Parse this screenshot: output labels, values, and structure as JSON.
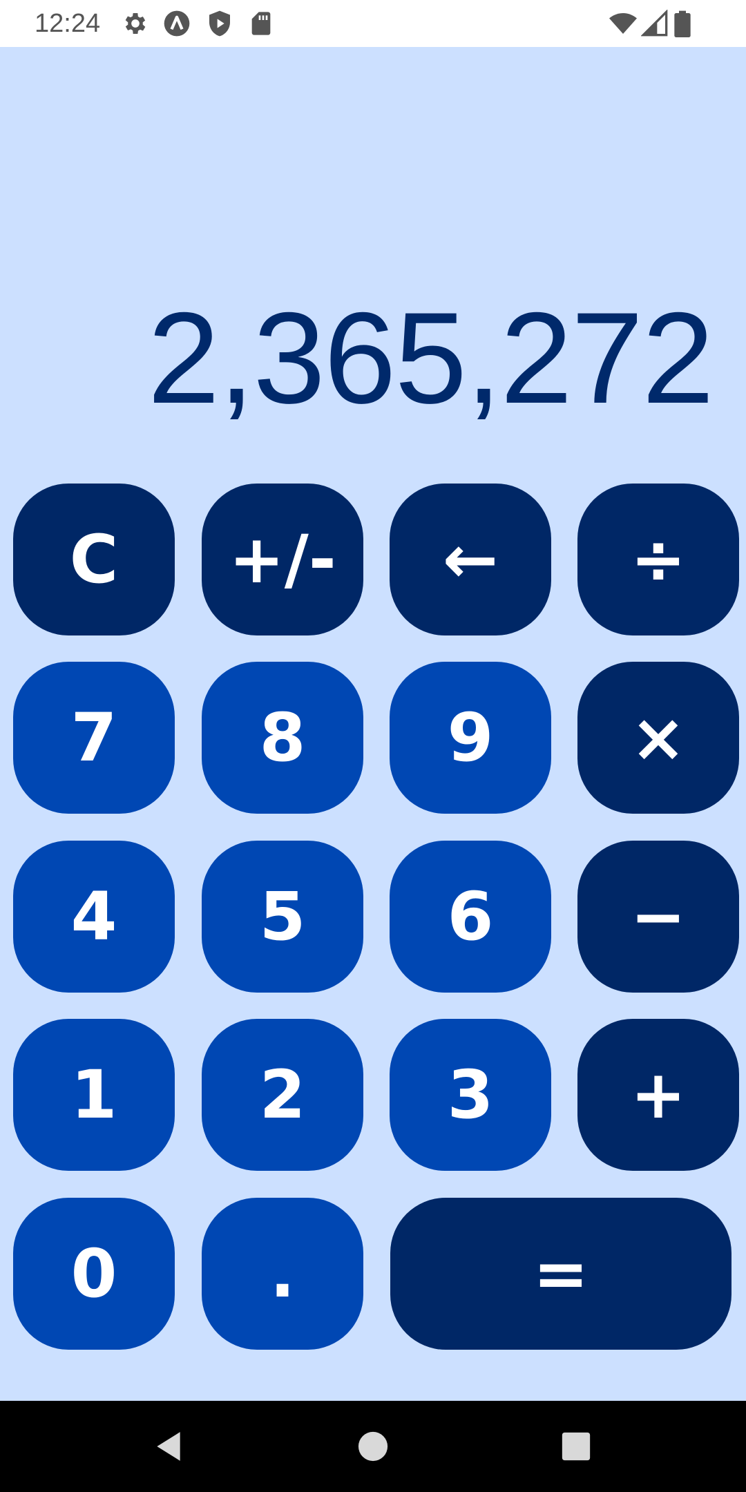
{
  "status_bar": {
    "time": "12:24",
    "left_icons": [
      "gear-icon",
      "a-circle-icon",
      "play-shield-icon",
      "sd-card-icon"
    ],
    "right_icons": [
      "wifi-icon",
      "signal-icon",
      "battery-icon"
    ]
  },
  "calculator": {
    "display_value": "2,365,272",
    "rows": [
      [
        "C",
        "+/-",
        "←",
        "÷"
      ],
      [
        "7",
        "8",
        "9",
        "×"
      ],
      [
        "4",
        "5",
        "6",
        "−"
      ],
      [
        "1",
        "2",
        "3",
        "+"
      ],
      [
        "0",
        ".",
        "="
      ]
    ]
  },
  "colors": {
    "background": "#cce0ff",
    "display_text": "#00296b",
    "function_key": "#002766",
    "digit_key": "#0047b3",
    "key_text": "#ffffff"
  },
  "nav_bar": {
    "buttons": [
      "back-icon",
      "home-icon",
      "recents-icon"
    ]
  }
}
